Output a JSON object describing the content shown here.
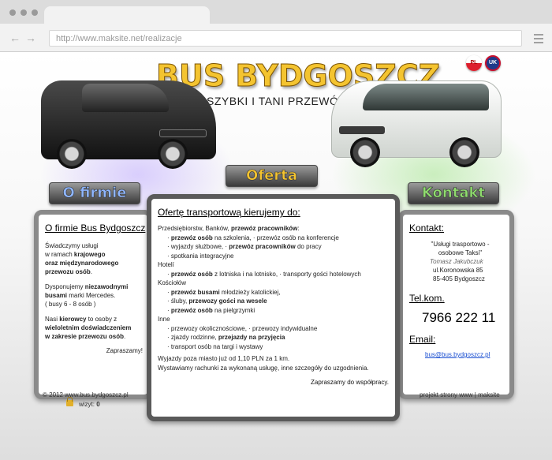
{
  "browser": {
    "url": "http://www.maksite.net/realizacje"
  },
  "header": {
    "logo": "BUS BYDGOSZCZ",
    "tagline": "SZYBKI I TANI PRZEWÓZ OSÓB",
    "flags": [
      "PL",
      "UK"
    ]
  },
  "nav": {
    "firmie": "O firmie",
    "oferta": "Oferta",
    "kontakt": "Kontakt"
  },
  "left": {
    "title": "O firmie Bus Bydgoszcz",
    "p1": [
      "Świadczymy usługi",
      "w ramach ",
      "krajowego",
      "oraz międzynarodowego",
      "przewozu osób",
      "."
    ],
    "p2": [
      "Dysponujemy ",
      "niezawodnymi",
      "busami",
      " marki Mercedes.",
      "( busy 6 - 8 osób )"
    ],
    "p3": [
      "Nasi ",
      "kierowcy",
      " to osoby z",
      "wieloletnim doświadczeniem",
      "w zakresie przewozu osób",
      "."
    ],
    "closing": "Zapraszamy!"
  },
  "center": {
    "title": "Ofertę transportową kierujemy do:",
    "lines": [
      {
        "t": "Przedsiębiorstw, Banków, przewóz pracowników:",
        "ind": false
      },
      {
        "t": "· przewóz osób na szkolenia,  · przewóz osób na konferencje",
        "ind": true
      },
      {
        "t": "· wyjazdy służbowe,  · przewóz pracowników do pracy",
        "ind": true
      },
      {
        "t": "· spotkania integracyjne",
        "ind": true
      },
      {
        "t": "Hotelí",
        "ind": false
      },
      {
        "t": "· przewóz osób z lotniska i na lotnisko,  · transporty gości hotelowych",
        "ind": true
      },
      {
        "t": "Kościołów",
        "ind": false
      },
      {
        "t": "· przewóz busami młodzieży katolickiej,",
        "ind": true
      },
      {
        "t": "· śluby, przewozy gości na wesele",
        "ind": true
      },
      {
        "t": "· przewóz osób na pielgrzymki",
        "ind": true
      },
      {
        "t": "Inne",
        "ind": false
      },
      {
        "t": "· przewozy okolicznościowe,  · przewozy indywidualne",
        "ind": true
      },
      {
        "t": "· zjazdy rodzinne, przejazdy na przyjęcia",
        "ind": true
      },
      {
        "t": "· transport osób na targi i wystawy",
        "ind": true
      }
    ],
    "footer1": "Wyjazdy poza miasto już od 1,10 PLN za 1 km.",
    "footer2": "Wystawiamy rachunki za wykonaną usługę, inne szczegóły do uzgodnienia.",
    "closing": "Zapraszamy do współpracy."
  },
  "right": {
    "contact_head": "Kontakt:",
    "quote1": "\"Usługi trasportowo -",
    "quote2": "osobowe Taksi\"",
    "name": "Tomasz Jakubczuk",
    "street": "ul.Koronowska 85",
    "city": "85-405 Bydgoszcz",
    "tel_head": "Tel.kom.",
    "phone": "7966 222 11",
    "email_head": "Email:",
    "email": "bus@bus.bydgoszcz.pl"
  },
  "footer": {
    "copyright": "© 2012 www.bus.bydgoszcz.pl",
    "visits_label": "wizyt: ",
    "visits_value": "0",
    "credit": "projekt strony www  |  maksite"
  }
}
